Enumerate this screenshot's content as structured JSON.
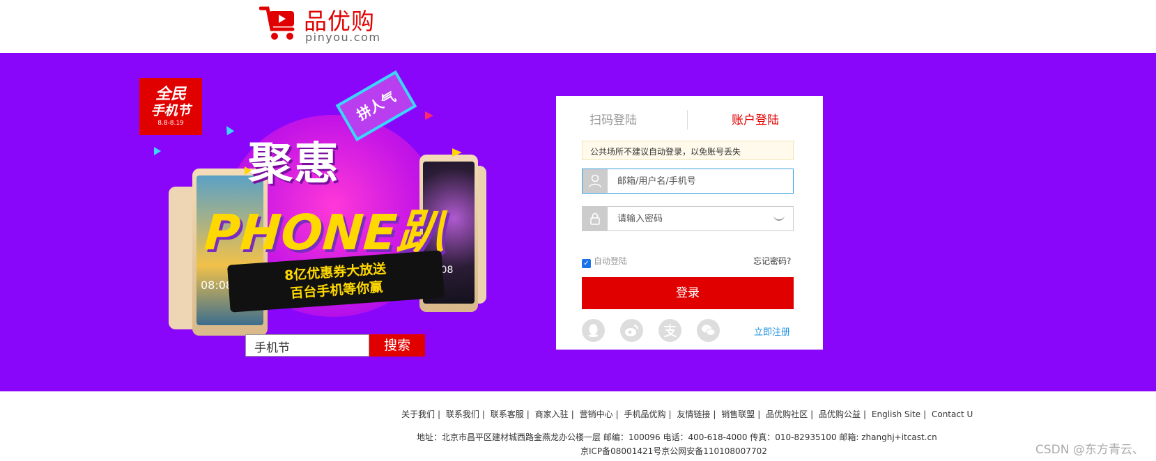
{
  "header": {
    "logo_title": "品优购",
    "logo_sub": "pinyou.com"
  },
  "banner": {
    "badge_line1": "全民",
    "badge_line2": "手机节",
    "badge_line3": "8.8-8.19",
    "ribbon_top": "拼人气",
    "headline_cn": "聚惠",
    "headline_en": "PHONE趴",
    "ribbon_line1": "8亿优惠券大放送",
    "ribbon_line2": "百台手机等你赢",
    "phone_time_left": "08:08",
    "phone_time_right": "10:08",
    "search": {
      "value": "手机节",
      "button_label": "搜索"
    }
  },
  "login": {
    "tab_qr": "扫码登陆",
    "tab_account": "账户登陆",
    "notice": "公共场所不建议自动登录，以免账号丢失",
    "username_placeholder": "邮箱/用户名/手机号",
    "password_placeholder": "请输入密码",
    "remember_label": "自动登陆",
    "remember_checked": true,
    "forgot_label": "忘记密码?",
    "submit_label": "登录",
    "social_icons": [
      "qq-icon",
      "weibo-icon",
      "alipay-icon",
      "wechat-icon"
    ],
    "register_label": "立即注册"
  },
  "footer": {
    "links": [
      "关于我们",
      "联系我们",
      "联系客服",
      "商家入驻",
      "营销中心",
      "手机品优购",
      "友情链接",
      "销售联盟",
      "品优购社区",
      "品优购公益",
      "English Site",
      "Contact U"
    ],
    "address": "地址：北京市昌平区建材城西路金燕龙办公楼一层 邮编：100096 电话：400-618-4000 传真：010-82935100 邮箱: zhanghj+itcast.cn",
    "icp": "京ICP备08001421号京公网安备110108007702"
  },
  "watermark": "CSDN @东方青云、",
  "colors": {
    "brand_red": "#e10000",
    "banner_purple": "#8a06fb",
    "link_blue": "#1a8fe0"
  }
}
